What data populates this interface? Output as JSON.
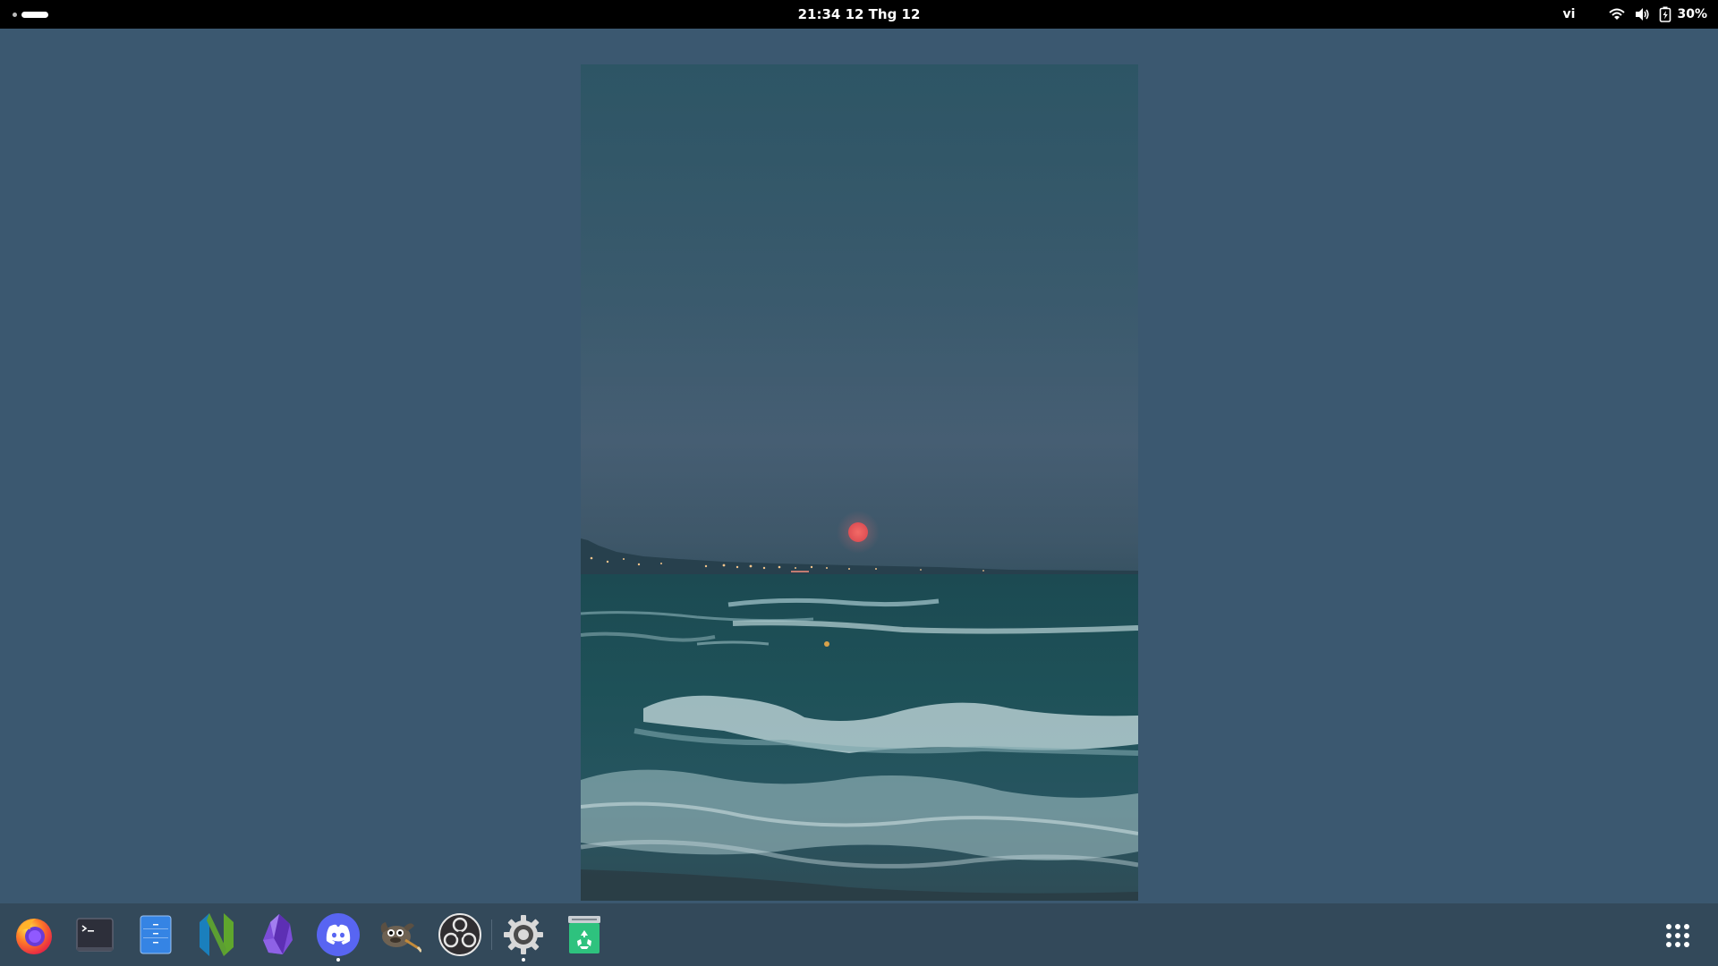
{
  "topbar": {
    "clock": "21:34  12 Thg 12",
    "language": "vi",
    "battery_percent": "30%",
    "icons": [
      "wifi-icon",
      "volume-icon",
      "battery-charging-icon"
    ]
  },
  "workspaces": {
    "count": 2,
    "active": 2
  },
  "wallpaper": {
    "subject": "moonrise over the sea at dusk",
    "colors": {
      "background": "#3b5870",
      "moon": "#e85c5c",
      "sea": "#1f4d55"
    }
  },
  "dock": {
    "apps": [
      {
        "name": "Firefox",
        "icon": "firefox-icon",
        "running": false
      },
      {
        "name": "Terminal",
        "icon": "terminal-icon",
        "running": false
      },
      {
        "name": "Files",
        "icon": "files-icon",
        "running": false
      },
      {
        "name": "Neovim",
        "icon": "neovim-icon",
        "running": false
      },
      {
        "name": "Obsidian",
        "icon": "obsidian-icon",
        "running": false
      },
      {
        "name": "Discord",
        "icon": "discord-icon",
        "running": true
      },
      {
        "name": "GIMP",
        "icon": "gimp-icon",
        "running": false
      },
      {
        "name": "OBS Studio",
        "icon": "obs-icon",
        "running": false
      },
      {
        "name": "Settings",
        "icon": "settings-gear-icon",
        "running": true
      },
      {
        "name": "Trash",
        "icon": "trash-icon",
        "running": false
      }
    ],
    "show_apps_icon": "app-grid-icon"
  }
}
